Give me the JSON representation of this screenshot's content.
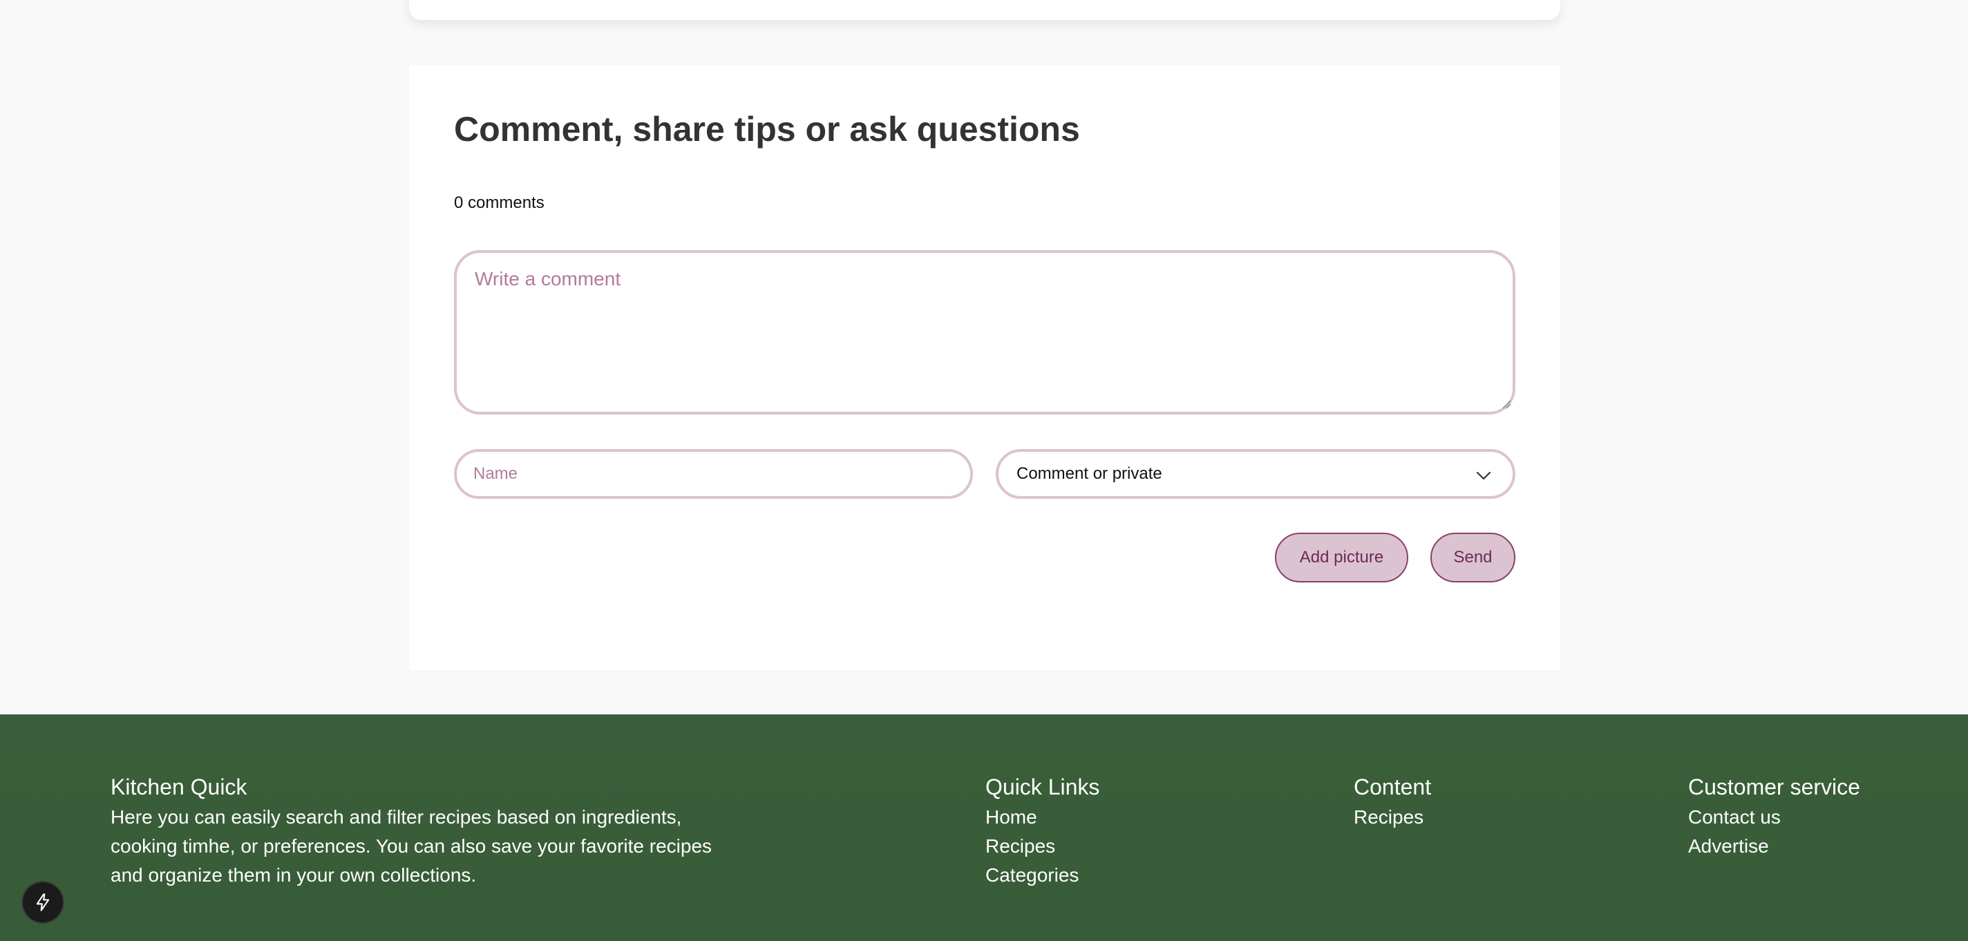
{
  "comments": {
    "title": "Comment, share tips or ask questions",
    "count_label": "0 comments",
    "textarea_placeholder": "Write a comment",
    "name_placeholder": "Name",
    "select_value": "Comment or private",
    "add_picture_label": "Add picture",
    "send_label": "Send"
  },
  "footer": {
    "about": {
      "heading": "Kitchen Quick",
      "text": "Here you can easily search and filter recipes based on ingredients, cooking timhe, or preferences. You can also save your favorite recipes and organize them in your own collections."
    },
    "quick_links": {
      "heading": "Quick Links",
      "links": [
        "Home",
        "Recipes",
        "Categories"
      ]
    },
    "content": {
      "heading": "Content",
      "links": [
        "Recipes"
      ]
    },
    "customer_service": {
      "heading": "Customer service",
      "links": [
        "Contact us",
        "Advertise"
      ]
    }
  },
  "icons": {
    "chevron": "chevron-down-icon",
    "bolt": "lightning-bolt-icon",
    "resize": "resize-grip-icon"
  },
  "colors": {
    "accent": "#8a3f6b",
    "input_border": "#dcc3d0",
    "placeholder": "#b37a9c",
    "footer_bg": "#3a5e39",
    "page_bg": "#f8f8f8"
  }
}
